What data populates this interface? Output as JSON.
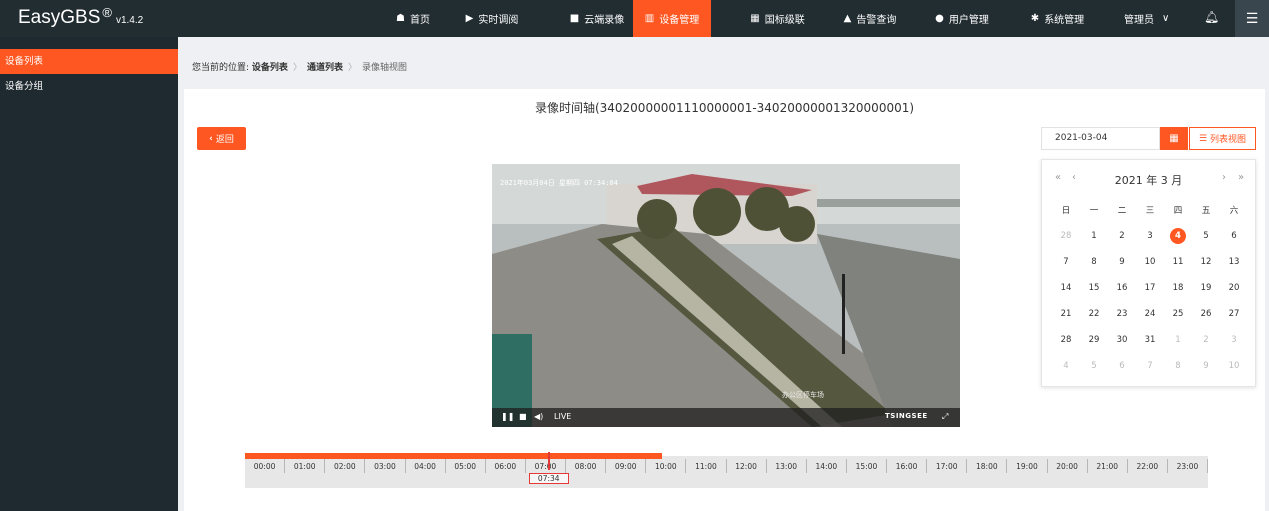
{
  "app": {
    "name": "EasyGBS",
    "reg": "®",
    "version": "v1.4.2"
  },
  "nav": [
    {
      "icon": "home-icon",
      "glyph": "☗",
      "label": "首页",
      "active": false
    },
    {
      "icon": "play-icon",
      "glyph": "▶",
      "label": "实时调阅",
      "active": false
    },
    {
      "icon": "video-camera-icon",
      "glyph": "■",
      "label": "云端录像",
      "active": false
    },
    {
      "icon": "device-icon",
      "glyph": "▥",
      "label": "设备管理",
      "active": true
    },
    {
      "icon": "grid-icon",
      "glyph": "▦",
      "label": "国标级联",
      "active": false
    },
    {
      "icon": "alarm-icon",
      "glyph": "▲",
      "label": "告警查询",
      "active": false
    },
    {
      "icon": "user-icon",
      "glyph": "●",
      "label": "用户管理",
      "active": false
    },
    {
      "icon": "gear-icon",
      "glyph": "✱",
      "label": "系统管理",
      "active": false
    }
  ],
  "user": {
    "label": "管理员",
    "chevron": "∨"
  },
  "sidebar": [
    {
      "label": "设备列表",
      "active": true
    },
    {
      "label": "设备分组",
      "active": false
    }
  ],
  "breadcrumb": {
    "prefix": "您当前的位置:",
    "items": [
      "设备列表",
      "通道列表"
    ],
    "current": "录像轴视图",
    "sep": "〉"
  },
  "page": {
    "title": "录像时间轴(34020000001110000001-34020000001320000001)",
    "back_label": "返回",
    "list_view_label": "列表视图"
  },
  "date_picker": {
    "value": "2021-03-04",
    "year_month": "2021 年  3 月",
    "prev_year": "«",
    "prev_month": "‹",
    "next_month": "›",
    "next_year": "»",
    "weekdays": [
      "日",
      "一",
      "二",
      "三",
      "四",
      "五",
      "六"
    ],
    "days": [
      {
        "d": "28",
        "t": "prev"
      },
      {
        "d": "1",
        "t": "cur"
      },
      {
        "d": "2",
        "t": "cur"
      },
      {
        "d": "3",
        "t": "cur"
      },
      {
        "d": "4",
        "t": "sel"
      },
      {
        "d": "5",
        "t": "cur"
      },
      {
        "d": "6",
        "t": "cur"
      },
      {
        "d": "7",
        "t": "cur"
      },
      {
        "d": "8",
        "t": "cur"
      },
      {
        "d": "9",
        "t": "cur"
      },
      {
        "d": "10",
        "t": "cur"
      },
      {
        "d": "11",
        "t": "cur"
      },
      {
        "d": "12",
        "t": "cur"
      },
      {
        "d": "13",
        "t": "cur"
      },
      {
        "d": "14",
        "t": "cur"
      },
      {
        "d": "15",
        "t": "cur"
      },
      {
        "d": "16",
        "t": "cur"
      },
      {
        "d": "17",
        "t": "cur"
      },
      {
        "d": "18",
        "t": "cur"
      },
      {
        "d": "19",
        "t": "cur"
      },
      {
        "d": "20",
        "t": "cur"
      },
      {
        "d": "21",
        "t": "cur"
      },
      {
        "d": "22",
        "t": "cur"
      },
      {
        "d": "23",
        "t": "cur"
      },
      {
        "d": "24",
        "t": "cur"
      },
      {
        "d": "25",
        "t": "cur"
      },
      {
        "d": "26",
        "t": "cur"
      },
      {
        "d": "27",
        "t": "cur"
      },
      {
        "d": "28",
        "t": "cur"
      },
      {
        "d": "29",
        "t": "cur"
      },
      {
        "d": "30",
        "t": "cur"
      },
      {
        "d": "31",
        "t": "cur"
      },
      {
        "d": "1",
        "t": "next"
      },
      {
        "d": "2",
        "t": "next"
      },
      {
        "d": "3",
        "t": "next"
      },
      {
        "d": "4",
        "t": "next"
      },
      {
        "d": "5",
        "t": "next"
      },
      {
        "d": "6",
        "t": "next"
      },
      {
        "d": "7",
        "t": "next"
      },
      {
        "d": "8",
        "t": "next"
      },
      {
        "d": "9",
        "t": "next"
      },
      {
        "d": "10",
        "t": "next"
      }
    ]
  },
  "video": {
    "osd_text": "2021年03月04日 星期四 07:34:04",
    "watermark": "办公区停车场",
    "live_label": "LIVE",
    "brand": "TSINGSEE"
  },
  "timeline": {
    "hours": [
      "00:00",
      "01:00",
      "02:00",
      "03:00",
      "04:00",
      "05:00",
      "06:00",
      "07:00",
      "08:00",
      "09:00",
      "10:00",
      "11:00",
      "12:00",
      "13:00",
      "14:00",
      "15:00",
      "16:00",
      "17:00",
      "18:00",
      "19:00",
      "20:00",
      "21:00",
      "22:00",
      "23:00"
    ],
    "recorded_until_hours": 10.4,
    "cursor_label": "07:34",
    "cursor_hours": 7.57
  },
  "colors": {
    "accent": "#ff5722",
    "topbar": "#222d32",
    "sidebar": "#1f2a30"
  }
}
